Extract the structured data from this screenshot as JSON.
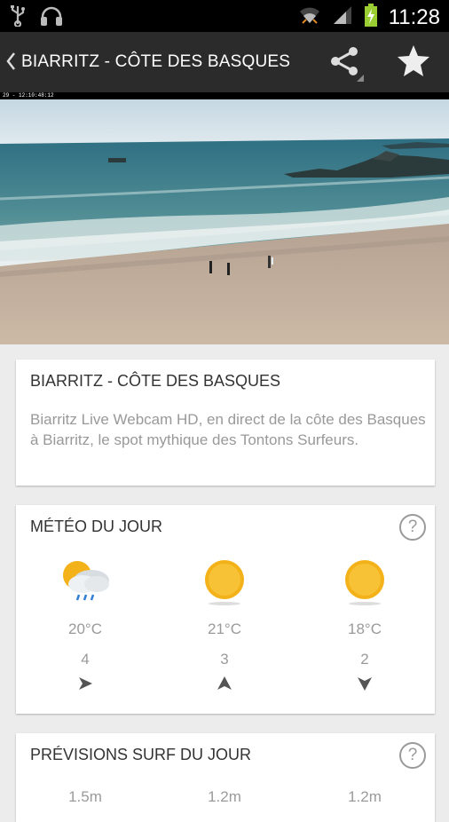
{
  "status_bar": {
    "time": "11:28",
    "icons": [
      "usb-icon",
      "headset-icon",
      "wifi-icon",
      "signal-icon",
      "battery-icon"
    ]
  },
  "action_bar": {
    "title": "BIARRITZ - CÔTE DES BASQUES",
    "icons": [
      "back-icon",
      "share-icon",
      "star-icon"
    ]
  },
  "webcam": {
    "stamp": "29 - 12:10:48:12"
  },
  "spot_card": {
    "title": "BIARRITZ - CÔTE DES BASQUES",
    "description": "Biarritz Live Webcam HD, en direct de la côte des Basques à Biarritz, le spot mythique des Tontons Surfeurs."
  },
  "weather_card": {
    "title": "MÉTÉO DU JOUR",
    "help": "?",
    "forecast": [
      {
        "icon": "cloud-rain-sun-icon",
        "temp": "20°C",
        "wind": "4",
        "wind_direction": "east"
      },
      {
        "icon": "sun-icon",
        "temp": "21°C",
        "wind": "3",
        "wind_direction": "north"
      },
      {
        "icon": "sun-icon",
        "temp": "18°C",
        "wind": "2",
        "wind_direction": "south"
      }
    ]
  },
  "surf_card": {
    "title": "PRÉVISIONS SURF DU JOUR",
    "help": "?",
    "waves": [
      "1.5m",
      "1.2m",
      "1.2m"
    ]
  }
}
